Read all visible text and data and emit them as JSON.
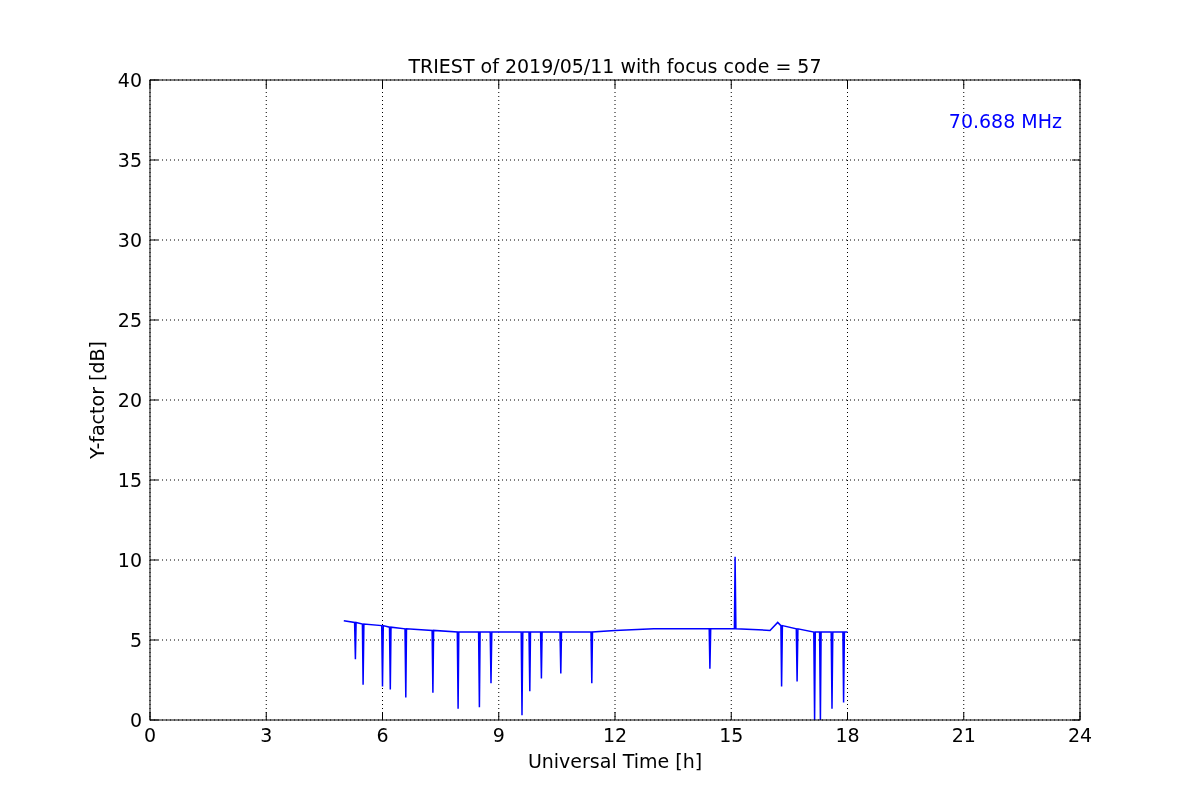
{
  "chart_data": {
    "type": "line",
    "title": "TRIEST of 2019/05/11 with focus code = 57",
    "xlabel": "Universal Time [h]",
    "ylabel": "Y-factor [dB]",
    "x": [
      5.0,
      5.28,
      5.3,
      5.32,
      5.48,
      5.5,
      5.52,
      5.98,
      6.0,
      6.02,
      6.18,
      6.2,
      6.22,
      6.58,
      6.6,
      6.62,
      7.28,
      7.3,
      7.32,
      7.93,
      7.95,
      7.97,
      8.48,
      8.5,
      8.52,
      8.78,
      8.8,
      8.82,
      9.58,
      9.6,
      9.62,
      9.78,
      9.8,
      9.82,
      10.08,
      10.1,
      10.12,
      10.58,
      10.6,
      10.62,
      11.38,
      11.4,
      11.42,
      12.0,
      13.0,
      14.0,
      14.43,
      14.45,
      14.47,
      15.08,
      15.1,
      15.12,
      16.0,
      16.2,
      16.28,
      16.3,
      16.32,
      16.68,
      16.7,
      16.72,
      17.13,
      17.15,
      17.17,
      17.28,
      17.3,
      17.32,
      17.58,
      17.6,
      17.62,
      17.88,
      17.9,
      17.92,
      18.0
    ],
    "series": [
      {
        "name": "70.688 MHz",
        "color": "#0000ff",
        "values": [
          6.2,
          6.1,
          3.8,
          6.1,
          6.0,
          2.2,
          6.0,
          5.9,
          2.1,
          5.9,
          5.8,
          1.9,
          5.8,
          5.7,
          1.4,
          5.7,
          5.6,
          1.7,
          5.6,
          5.5,
          0.7,
          5.5,
          5.5,
          0.8,
          5.5,
          5.5,
          2.3,
          5.5,
          5.5,
          0.3,
          5.5,
          5.5,
          1.8,
          5.5,
          5.5,
          2.6,
          5.5,
          5.5,
          2.9,
          5.5,
          5.5,
          2.3,
          5.5,
          5.6,
          5.7,
          5.7,
          5.7,
          3.2,
          5.7,
          5.7,
          10.2,
          5.7,
          5.6,
          6.1,
          5.9,
          2.1,
          5.9,
          5.7,
          2.4,
          5.7,
          5.5,
          0.0,
          5.5,
          5.5,
          0.0,
          5.5,
          5.5,
          0.7,
          5.5,
          5.5,
          1.1,
          5.5,
          5.5
        ]
      }
    ],
    "xlim": [
      0,
      24
    ],
    "ylim": [
      0,
      40
    ],
    "xticks": [
      0,
      3,
      6,
      9,
      12,
      15,
      18,
      21,
      24
    ],
    "yticks": [
      0,
      5,
      10,
      15,
      20,
      25,
      30,
      35,
      40
    ],
    "grid": true
  }
}
